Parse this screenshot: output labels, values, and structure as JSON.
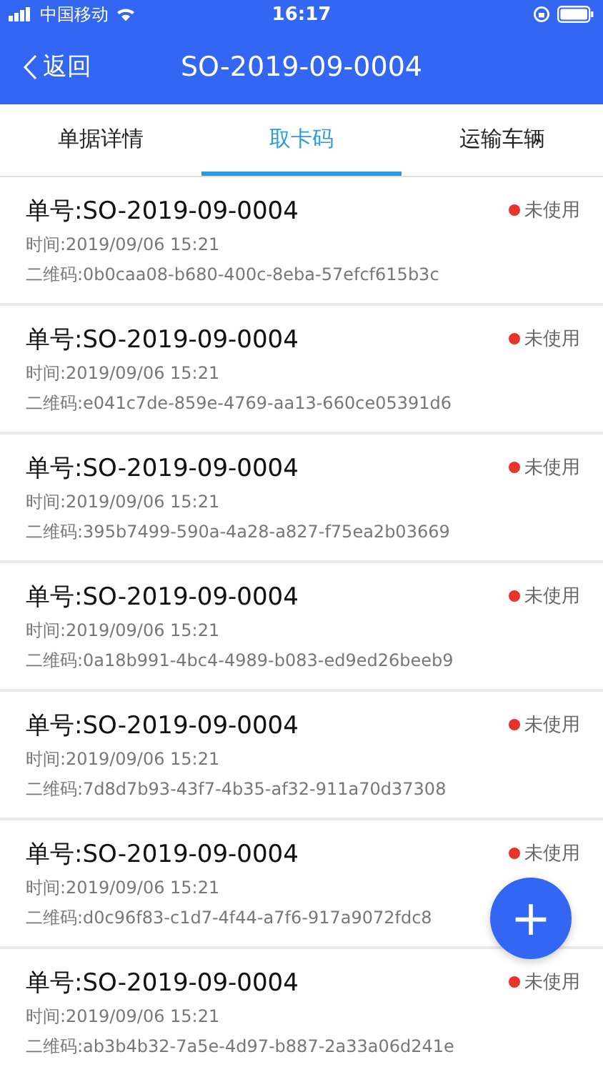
{
  "status_bar": {
    "carrier": "中国移动",
    "time": "16:17"
  },
  "nav": {
    "back": "返回",
    "title": "SO-2019-09-0004"
  },
  "tabs": [
    {
      "label": "单据详情",
      "selected": false
    },
    {
      "label": "取卡码",
      "selected": true
    },
    {
      "label": "运输车辆",
      "selected": false
    }
  ],
  "cards": [
    {
      "order": "单号:SO-2019-09-0004",
      "time": "时间:2019/09/06 15:21",
      "code": "二维码:0b0caa08-b680-400c-8eba-57efcf615b3c",
      "status": "未使用",
      "color": "#e8342a"
    },
    {
      "order": "单号:SO-2019-09-0004",
      "time": "时间:2019/09/06 15:21",
      "code": "二维码:e041c7de-859e-4769-aa13-660ce05391d6",
      "status": "未使用",
      "color": "#e8342a"
    },
    {
      "order": "单号:SO-2019-09-0004",
      "time": "时间:2019/09/06 15:21",
      "code": "二维码:395b7499-590a-4a28-a827-f75ea2b03669",
      "status": "未使用",
      "color": "#e8342a"
    },
    {
      "order": "单号:SO-2019-09-0004",
      "time": "时间:2019/09/06 15:21",
      "code": "二维码:0a18b991-4bc4-4989-b083-ed9ed26beeb9",
      "status": "未使用",
      "color": "#e8342a"
    },
    {
      "order": "单号:SO-2019-09-0004",
      "time": "时间:2019/09/06 15:21",
      "code": "二维码:7d8d7b93-43f7-4b35-af32-911a70d37308",
      "status": "未使用",
      "color": "#e8342a"
    },
    {
      "order": "单号:SO-2019-09-0004",
      "time": "时间:2019/09/06 15:21",
      "code": "二维码:d0c96f83-c1d7-4f44-a7f6-917a9072fdc8",
      "status": "未使用",
      "color": "#e8342a"
    },
    {
      "order": "单号:SO-2019-09-0004",
      "time": "时间:2019/09/06 15:21",
      "code": "二维码:ab3b4b32-7a5e-4d97-b887-2a33a06d241e",
      "status": "未使用",
      "color": "#e8342a"
    }
  ],
  "fab": {
    "label": "+"
  }
}
